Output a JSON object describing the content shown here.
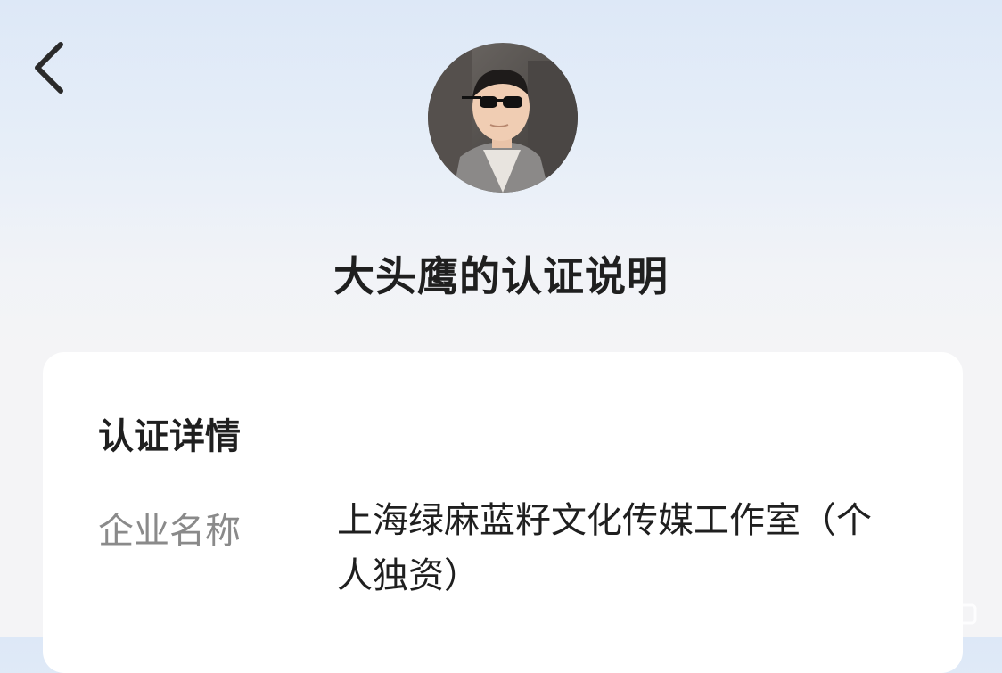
{
  "header": {
    "title": "大头鹰的认证说明",
    "back_icon": "chevron-left-icon"
  },
  "profile": {
    "avatar_description": "avatar"
  },
  "certification": {
    "section_title": "认证详情",
    "fields": [
      {
        "label": "企业名称",
        "value": "上海绿麻蓝籽文化传媒工作室（个人独资）"
      }
    ]
  },
  "colors": {
    "title_text": "#1f1f1f",
    "label_text": "#8a8a8a",
    "card_bg": "#ffffff",
    "bg_top": "#dde8f7",
    "bg_bottom": "#f4f4f6"
  }
}
